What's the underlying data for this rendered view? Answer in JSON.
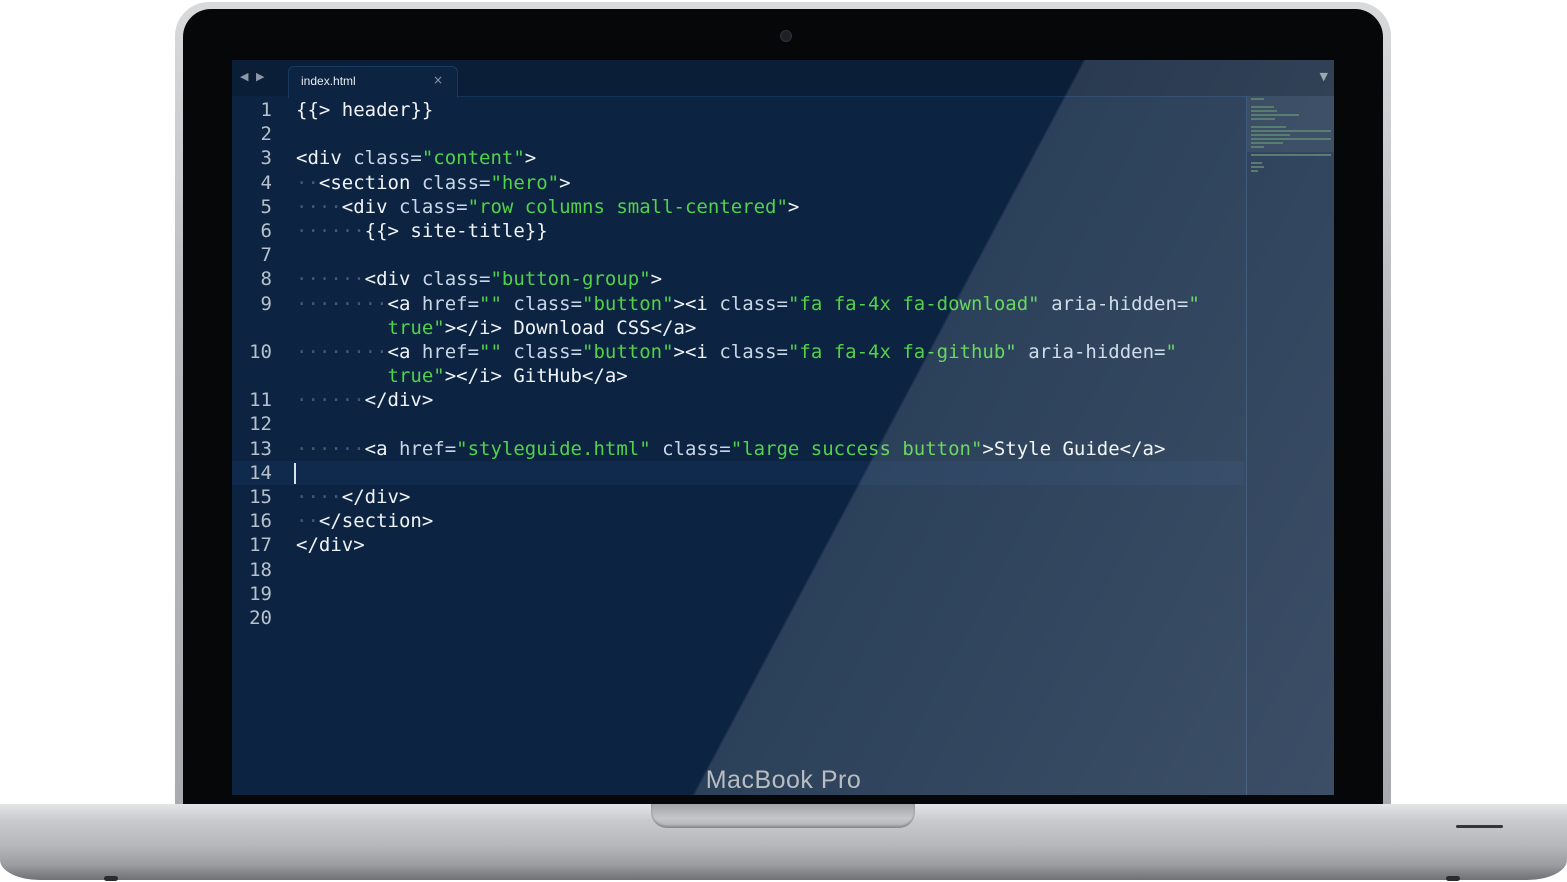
{
  "device": {
    "brand_label": "MacBook Pro"
  },
  "editor": {
    "tab": {
      "label": "index.html",
      "close_glyph": "×"
    },
    "nav_glyph": "◀ ▶",
    "menu_glyph": "▼",
    "current_line": 14,
    "colors": {
      "background": "#0c2441",
      "tag": "#f0f3f6",
      "attribute": "#c7d7e6",
      "string": "#52d14a",
      "line_number": "#b7c1cc"
    },
    "lines": [
      {
        "num": "1",
        "segments": [
          [
            "t",
            "{{> header}}"
          ]
        ]
      },
      {
        "num": "2",
        "segments": []
      },
      {
        "num": "3",
        "segments": [
          [
            "t",
            "<div "
          ],
          [
            "a",
            "class="
          ],
          [
            "s",
            "\"content\""
          ],
          [
            "t",
            ">"
          ]
        ]
      },
      {
        "num": "4",
        "segments": [
          [
            "ind",
            "··"
          ],
          [
            "t",
            "<section "
          ],
          [
            "a",
            "class="
          ],
          [
            "s",
            "\"hero\""
          ],
          [
            "t",
            ">"
          ]
        ]
      },
      {
        "num": "5",
        "segments": [
          [
            "ind",
            "····"
          ],
          [
            "t",
            "<div "
          ],
          [
            "a",
            "class="
          ],
          [
            "s",
            "\"row columns small-centered\""
          ],
          [
            "t",
            ">"
          ]
        ]
      },
      {
        "num": "6",
        "segments": [
          [
            "ind",
            "······"
          ],
          [
            "t",
            "{{> site-title}}"
          ]
        ]
      },
      {
        "num": "7",
        "segments": []
      },
      {
        "num": "8",
        "segments": [
          [
            "ind",
            "······"
          ],
          [
            "t",
            "<div "
          ],
          [
            "a",
            "class="
          ],
          [
            "s",
            "\"button-group\""
          ],
          [
            "t",
            ">"
          ]
        ]
      },
      {
        "num": "9",
        "segments": [
          [
            "ind",
            "········"
          ],
          [
            "t",
            "<a "
          ],
          [
            "a",
            "href="
          ],
          [
            "s",
            "\"\""
          ],
          [
            "t",
            " "
          ],
          [
            "a",
            "class="
          ],
          [
            "s",
            "\"button\""
          ],
          [
            "t",
            "><i "
          ],
          [
            "a",
            "class="
          ],
          [
            "s",
            "\"fa fa-4x fa-download\""
          ],
          [
            "t",
            " "
          ],
          [
            "a",
            "aria-hidden="
          ],
          [
            "s",
            "\""
          ]
        ]
      },
      {
        "num": "",
        "segments": [
          [
            "ind",
            "        "
          ],
          [
            "s",
            "true\""
          ],
          [
            "t",
            "></i> Download CSS</a>"
          ]
        ]
      },
      {
        "num": "10",
        "segments": [
          [
            "ind",
            "········"
          ],
          [
            "t",
            "<a "
          ],
          [
            "a",
            "href="
          ],
          [
            "s",
            "\"\""
          ],
          [
            "t",
            " "
          ],
          [
            "a",
            "class="
          ],
          [
            "s",
            "\"button\""
          ],
          [
            "t",
            "><i "
          ],
          [
            "a",
            "class="
          ],
          [
            "s",
            "\"fa fa-4x fa-github\""
          ],
          [
            "t",
            " "
          ],
          [
            "a",
            "aria-hidden="
          ],
          [
            "s",
            "\""
          ]
        ]
      },
      {
        "num": "",
        "segments": [
          [
            "ind",
            "        "
          ],
          [
            "s",
            "true\""
          ],
          [
            "t",
            "></i> GitHub</a>"
          ]
        ]
      },
      {
        "num": "11",
        "segments": [
          [
            "ind",
            "······"
          ],
          [
            "t",
            "</div>"
          ]
        ]
      },
      {
        "num": "12",
        "segments": []
      },
      {
        "num": "13",
        "segments": [
          [
            "ind",
            "······"
          ],
          [
            "t",
            "<a "
          ],
          [
            "a",
            "href="
          ],
          [
            "s",
            "\"styleguide.html\""
          ],
          [
            "t",
            " "
          ],
          [
            "a",
            "class="
          ],
          [
            "s",
            "\"large success button\""
          ],
          [
            "t",
            ">Style Guide</a>"
          ]
        ]
      },
      {
        "num": "14",
        "segments": []
      },
      {
        "num": "15",
        "segments": [
          [
            "ind",
            "····"
          ],
          [
            "t",
            "</div>"
          ]
        ]
      },
      {
        "num": "16",
        "segments": [
          [
            "ind",
            "··"
          ],
          [
            "t",
            "</section>"
          ]
        ]
      },
      {
        "num": "17",
        "segments": [
          [
            "t",
            "</div>"
          ]
        ]
      },
      {
        "num": "18",
        "segments": []
      },
      {
        "num": "19",
        "segments": []
      },
      {
        "num": "20",
        "segments": []
      }
    ]
  }
}
